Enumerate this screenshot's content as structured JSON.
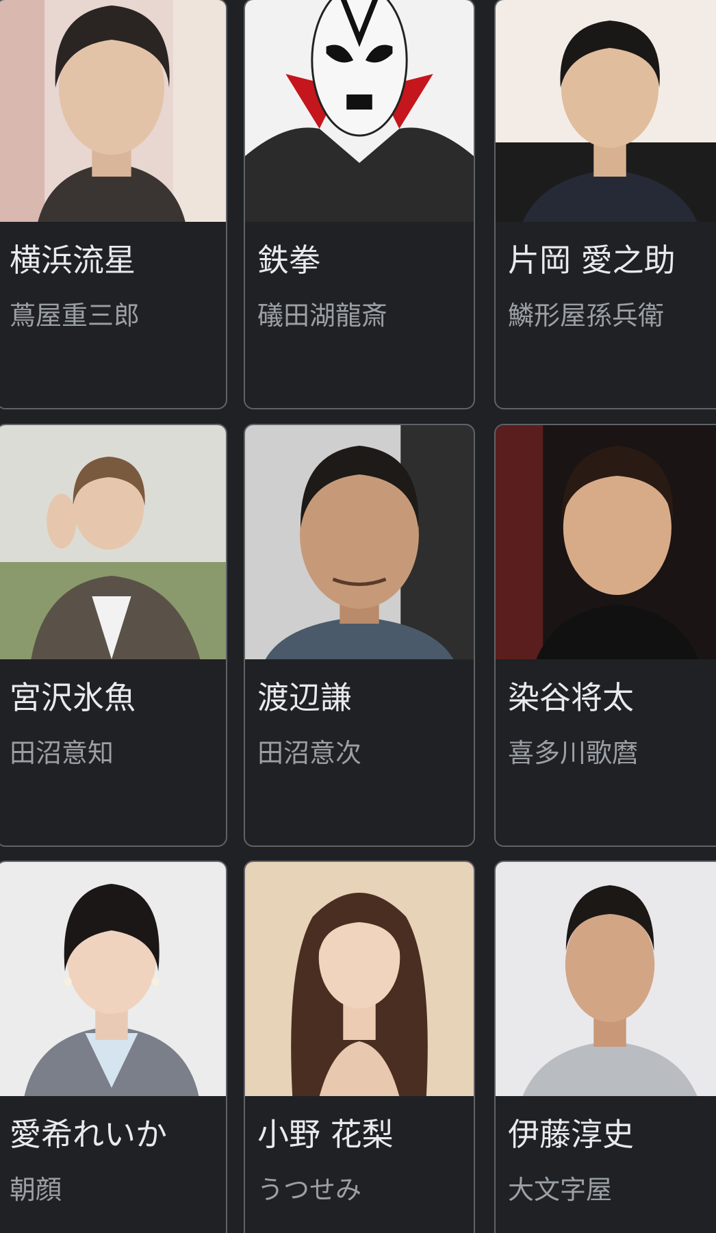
{
  "cast": [
    {
      "actor": "横浜流星",
      "role": "蔦屋重三郎",
      "photo_icon": "person-photo-icon"
    },
    {
      "actor": "鉄拳",
      "role": "礒田湖龍斎",
      "photo_icon": "person-photo-icon"
    },
    {
      "actor": "片岡 愛之助",
      "role": "鱗形屋孫兵衛",
      "photo_icon": "person-photo-icon"
    },
    {
      "actor": "宮沢氷魚",
      "role": "田沼意知",
      "photo_icon": "person-photo-icon"
    },
    {
      "actor": "渡辺謙",
      "role": "田沼意次",
      "photo_icon": "person-photo-icon"
    },
    {
      "actor": "染谷将太",
      "role": "喜多川歌麿",
      "photo_icon": "person-photo-icon"
    },
    {
      "actor": "愛希れいか",
      "role": "朝顔",
      "photo_icon": "person-photo-icon"
    },
    {
      "actor": "小野 花梨",
      "role": "うつせみ",
      "photo_icon": "person-photo-icon"
    },
    {
      "actor": "伊藤淳史",
      "role": "大文字屋",
      "photo_icon": "person-photo-icon"
    }
  ],
  "colors": {
    "background": "#202124",
    "card_border": "#5f6368",
    "name_text": "#e8eaed",
    "role_text": "#9aa0a6"
  }
}
